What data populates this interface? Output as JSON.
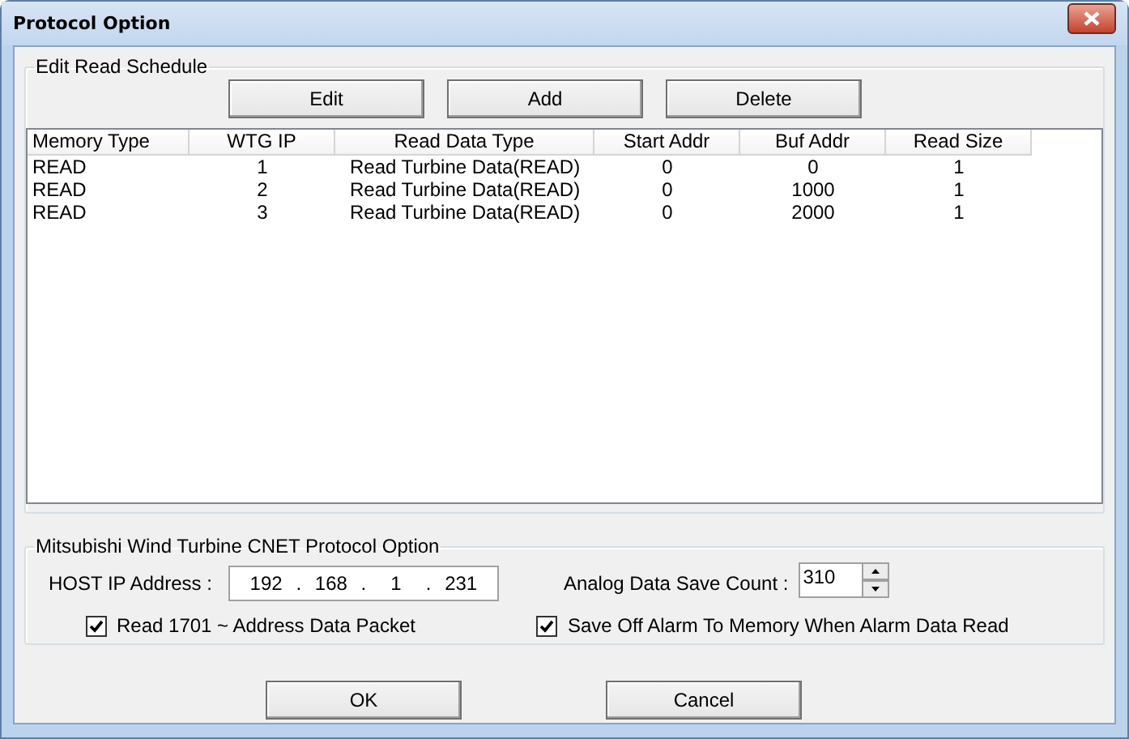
{
  "window": {
    "title": "Protocol Option"
  },
  "schedule": {
    "title": "Edit Read Schedule",
    "buttons": [
      "Edit",
      "Add",
      "Delete"
    ],
    "columns": [
      "Memory Type",
      "WTG IP",
      "Read Data Type",
      "Start Addr",
      "Buf Addr",
      "Read Size"
    ],
    "rows": [
      [
        "READ",
        "1",
        "Read Turbine Data(READ)",
        "0",
        "0",
        "1"
      ],
      [
        "READ",
        "2",
        "Read Turbine Data(READ)",
        "0",
        "1000",
        "1"
      ],
      [
        "READ",
        "3",
        "Read Turbine Data(READ)",
        "0",
        "2000",
        "1"
      ]
    ]
  },
  "cnet": {
    "title": "Mitsubishi Wind Turbine CNET Protocol Option",
    "host_ip": {
      "label": "HOST IP Address :",
      "octets": [
        "192",
        "168",
        "1",
        "231"
      ],
      "separator": "."
    },
    "save_count": {
      "label": "Analog Data Save Count :",
      "value": "310"
    },
    "checkboxes": [
      {
        "label": "Read 1701 ~ Address Data Packet",
        "checked": true
      },
      {
        "label": "Save Off Alarm To Memory When Alarm Data Read",
        "checked": true
      }
    ]
  },
  "buttons": [
    "OK",
    "Cancel"
  ]
}
